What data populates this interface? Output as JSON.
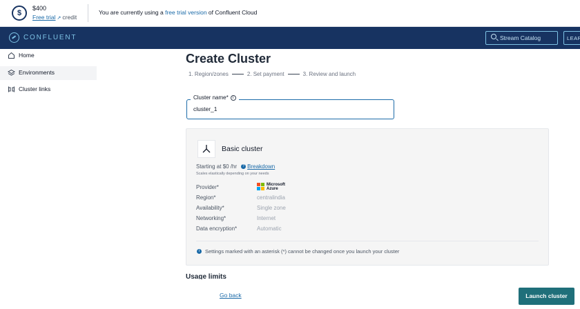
{
  "promo": {
    "amount": "$400",
    "free_trial_link": "Free trial",
    "credit_word": "credit",
    "message_prefix": "You are currently using a ",
    "message_link": "free trial version",
    "message_suffix": " of Confluent Cloud"
  },
  "navbar": {
    "logo_text": "CONFLUENT",
    "search_placeholder": "Stream Catalog",
    "learn_label": "LEARN"
  },
  "sidebar": {
    "items": [
      {
        "label": "Home",
        "icon": "home-icon",
        "active": false
      },
      {
        "label": "Environments",
        "icon": "layers-icon",
        "active": true
      },
      {
        "label": "Cluster links",
        "icon": "link-icon",
        "active": false
      }
    ]
  },
  "main": {
    "title": "Create Cluster",
    "steps": [
      "1. Region/zones",
      "2. Set payment",
      "3. Review and launch"
    ],
    "cluster_name_label": "Cluster name*",
    "cluster_name_value": "cluster_1"
  },
  "card": {
    "title": "Basic cluster",
    "starting_price": "Starting at $0 /hr",
    "breakdown_link": "Breakdown",
    "scales_text": "Scales elastically depending on your needs",
    "properties": [
      {
        "label": "Provider*",
        "value": "Microsoft Azure"
      },
      {
        "label": "Region*",
        "value": "centralindia"
      },
      {
        "label": "Availability*",
        "value": "Single zone"
      },
      {
        "label": "Networking*",
        "value": "Internet"
      },
      {
        "label": "Data encryption*",
        "value": "Automatic"
      }
    ],
    "provider_line1": "Microsoft",
    "provider_line2": "Azure",
    "note": "Settings marked with an asterisk (*) cannot be changed once you launch your cluster"
  },
  "usage_limits_title": "Usage limits",
  "footer": {
    "go_back": "Go back",
    "launch": "Launch cluster"
  },
  "colors": {
    "navbar": "#173361",
    "accent": "#1a6aa8",
    "launch_button": "#1f6f7a"
  }
}
